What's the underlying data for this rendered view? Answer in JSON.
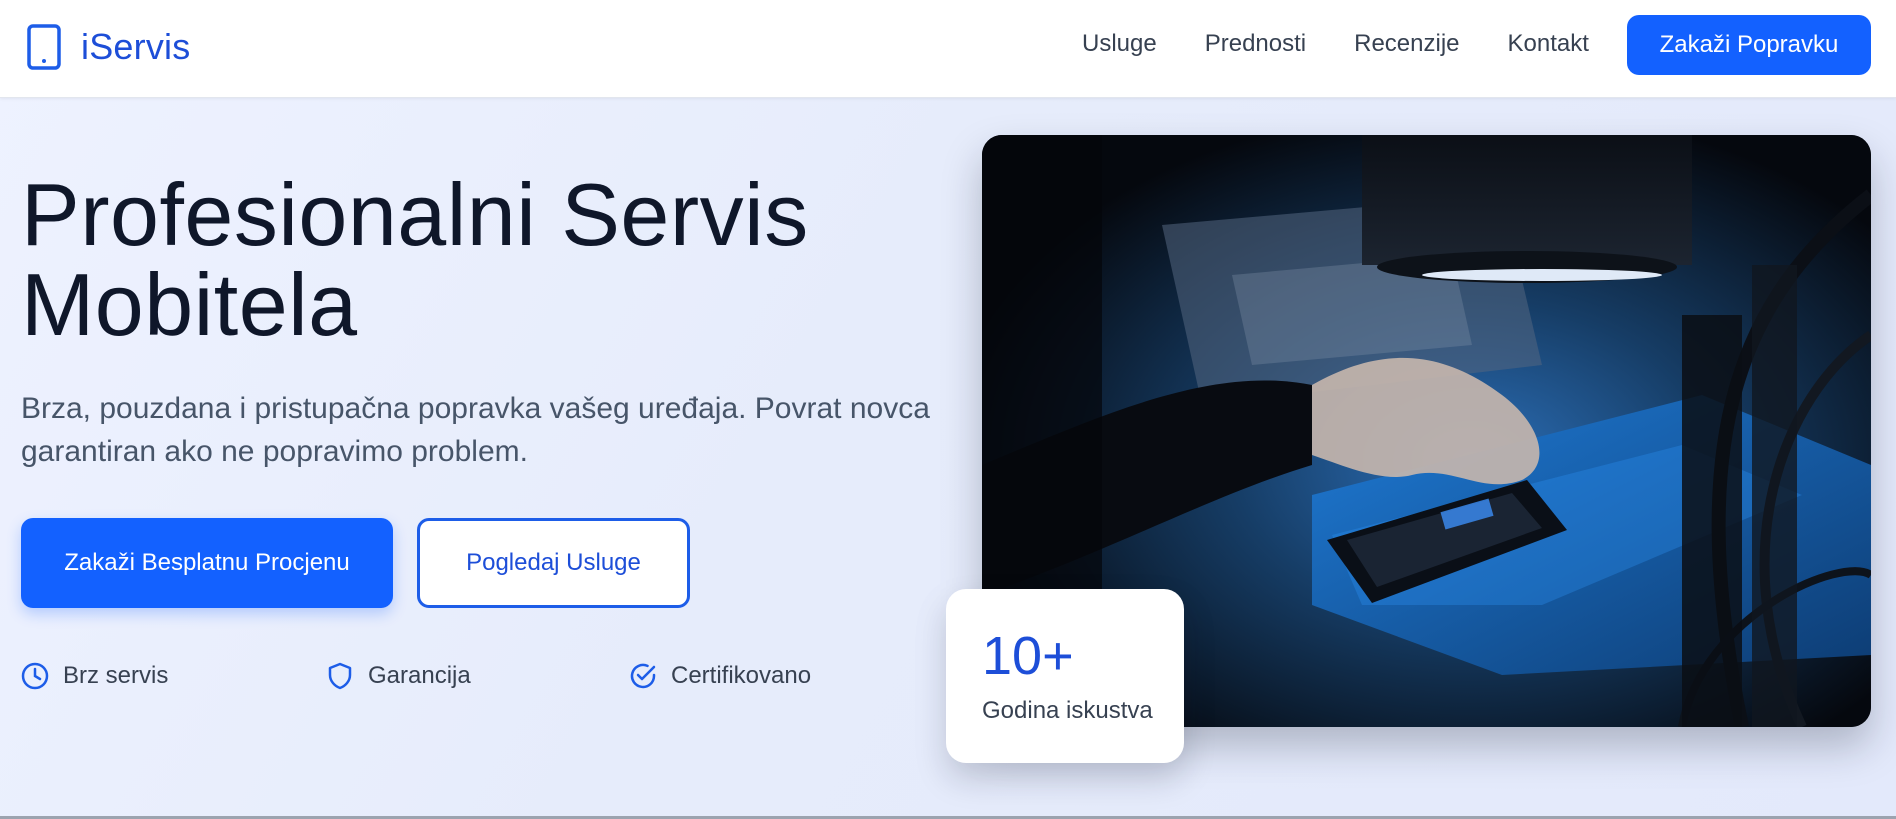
{
  "brand": {
    "name": "iServis",
    "logo_icon": "smartphone-icon",
    "accent_color": "#1361ff"
  },
  "nav": {
    "items": [
      "Usluge",
      "Prednosti",
      "Recenzije",
      "Kontakt"
    ],
    "cta_label": "Zakaži Popravku"
  },
  "hero": {
    "title_line1": "Profesionalni Servis",
    "title_line2": "Mobitela",
    "subtitle_line1": "Brza, pouzdana i pristupačna popravka vašeg uređaja. Povrat novca",
    "subtitle_line2": "garantiran ako ne popravimo problem.",
    "primary_button": "Zakaži Besplatnu Procjenu",
    "secondary_button": "Pogledaj Usluge",
    "features": [
      {
        "label": "Brz servis",
        "icon": "clock-icon"
      },
      {
        "label": "Garancija",
        "icon": "shield-icon"
      },
      {
        "label": "Certifikovano",
        "icon": "check-circle-icon"
      }
    ]
  },
  "stat": {
    "value": "10+",
    "label": "Godina iskustva"
  }
}
